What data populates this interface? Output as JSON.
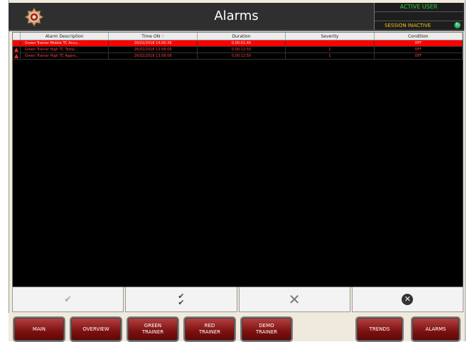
{
  "header": {
    "title": "Alarms",
    "active_user_label": "ACTIVE USER",
    "user_name": "",
    "session_status": "SESSION INACTIVE"
  },
  "table": {
    "columns": [
      "Alarm Description",
      "Time ON",
      "Duration",
      "Severity",
      "Condition"
    ],
    "rows": [
      {
        "selected": true,
        "warning": false,
        "description": "Green Trainer Mobile TC Accu...",
        "time_on": "26/02/2018 14:00:36",
        "duration": "0,00:01:40",
        "severity": "",
        "condition": "OFF"
      },
      {
        "selected": false,
        "warning": true,
        "description": "Green Trainer High TC Temp...",
        "time_on": "26/02/2018 13:58:06",
        "duration": "0,00:12:50",
        "severity": "1",
        "condition": "OFF"
      },
      {
        "selected": false,
        "warning": true,
        "description": "Green Trainer High TC Appro...",
        "time_on": "26/02/2018 13:58:06",
        "duration": "0,00:12:50",
        "severity": "1",
        "condition": "OFF"
      }
    ]
  },
  "actions": [
    {
      "name": "acknowledge-button",
      "icon": "check-icon",
      "glyph": "✔",
      "enabled": false
    },
    {
      "name": "acknowledge-all-button",
      "icon": "double-check-icon",
      "glyph": "✔✔",
      "enabled": true
    },
    {
      "name": "clear-button",
      "icon": "cross-icon",
      "glyph": "✕",
      "enabled": true
    },
    {
      "name": "close-alarms-button",
      "icon": "close-circle-icon",
      "glyph": "✕",
      "enabled": true
    }
  ],
  "nav": {
    "main": "MAIN",
    "overview": "OVERVIEW",
    "green_trainer": "GREEN\nTRAINER",
    "red_trainer": "RED\nTRAINER",
    "demo_trainer": "DEMO\nTRAINER",
    "trends": "TRENDS",
    "alarms": "ALARMS"
  },
  "colors": {
    "selected_row": "#ff0000",
    "alarm_text": "#ff4444",
    "nav_button": "#8b1a1a",
    "active_user": "#2ecc40",
    "session_inactive": "#f1c40f"
  }
}
